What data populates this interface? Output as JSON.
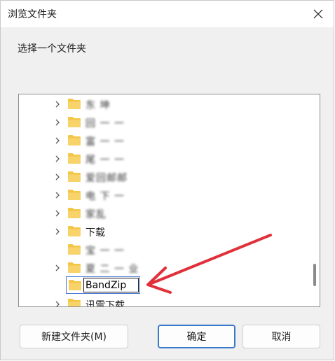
{
  "window": {
    "title": "浏览文件夹",
    "prompt": "选择一个文件夹"
  },
  "tree": {
    "items": [
      {
        "label": "东 坤",
        "expandable": true,
        "blurred": true
      },
      {
        "label": "回 一 一",
        "expandable": true,
        "blurred": true
      },
      {
        "label": "富 一 一",
        "expandable": true,
        "blurred": true
      },
      {
        "label": "尾 一 一",
        "expandable": true,
        "blurred": true
      },
      {
        "label": "爱回邮邮",
        "expandable": true,
        "blurred": true
      },
      {
        "label": "电 下 一",
        "expandable": true,
        "blurred": true
      },
      {
        "label": "家乱",
        "expandable": true,
        "blurred": true
      },
      {
        "label": "下载",
        "expandable": true,
        "blurred": false
      },
      {
        "label": "宝 一 一",
        "expandable": false,
        "blurred": true
      },
      {
        "label": "夏 二 一 业",
        "expandable": true,
        "blurred": true
      },
      {
        "label": "讯雷下载",
        "expandable": true,
        "blurred": false
      }
    ],
    "editing": {
      "value": "BandZip"
    }
  },
  "buttons": {
    "new_folder": "新建文件夹(M)",
    "ok": "确定",
    "cancel": "取消"
  },
  "colors": {
    "folder": "#f4c645",
    "annotation_arrow": "#e0303a",
    "focus_border": "#3a78c9"
  }
}
